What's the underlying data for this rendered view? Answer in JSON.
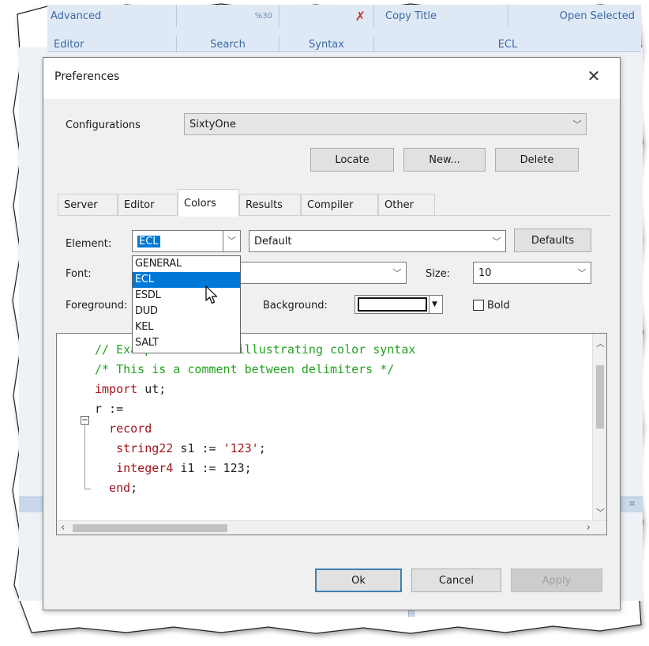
{
  "background_app": {
    "ribbon_top": [
      "Advanced",
      "Copy Title",
      "Open Selected"
    ],
    "ribbon_groups": [
      "Editor",
      "Search",
      "Syntax",
      "ECL"
    ],
    "small_label": "%30"
  },
  "dialog": {
    "title": "Preferences",
    "close_glyph": "✕",
    "configurations": {
      "label": "Configurations",
      "value": "SixtyOne"
    },
    "config_buttons": {
      "locate": "Locate",
      "new": "New...",
      "delete": "Delete"
    },
    "tabs": [
      {
        "label": "Server",
        "active": false
      },
      {
        "label": "Editor",
        "active": false
      },
      {
        "label": "Colors",
        "active": true
      },
      {
        "label": "Results",
        "active": false
      },
      {
        "label": "Compiler",
        "active": false
      },
      {
        "label": "Other",
        "active": false
      }
    ],
    "element": {
      "label": "Element:",
      "value": "ECL",
      "style_value": "Default",
      "defaults_button": "Defaults",
      "options": [
        "GENERAL",
        "ECL",
        "ESDL",
        "DUD",
        "KEL",
        "SALT"
      ],
      "selected_option": "ECL"
    },
    "font": {
      "label": "Font:",
      "value": "",
      "size_label": "Size:",
      "size_value": "10"
    },
    "foreground_label": "Foreground:",
    "background_label": "Background:",
    "bold_label": "Bold",
    "preview_lines": [
      [
        {
          "t": "// Example text for illustrating color syntax",
          "c": "comment"
        }
      ],
      [
        {
          "t": "/* This is a comment between delimiters */",
          "c": "comment"
        }
      ],
      [
        {
          "t": "import",
          "c": "kw"
        },
        {
          "t": " ut;",
          "c": "plain"
        }
      ],
      [
        {
          "t": "r :=",
          "c": "plain"
        }
      ],
      [
        {
          "t": "  record",
          "c": "kw"
        }
      ],
      [
        {
          "t": "   string22",
          "c": "kw"
        },
        {
          "t": " s1 := ",
          "c": "plain"
        },
        {
          "t": "'123'",
          "c": "str"
        },
        {
          "t": ";",
          "c": "plain"
        }
      ],
      [
        {
          "t": "   integer4",
          "c": "kw"
        },
        {
          "t": " i1 := 123;",
          "c": "plain"
        }
      ],
      [
        {
          "t": "  end",
          "c": "kw"
        },
        {
          "t": ";",
          "c": "plain"
        }
      ]
    ],
    "footer_buttons": {
      "ok": "Ok",
      "cancel": "Cancel",
      "apply": "Apply"
    }
  },
  "colors": {
    "selection": "#0078d7",
    "comment": "#22a31f",
    "keyword": "#a3151d",
    "ribbon_text": "#3d6aa3"
  }
}
